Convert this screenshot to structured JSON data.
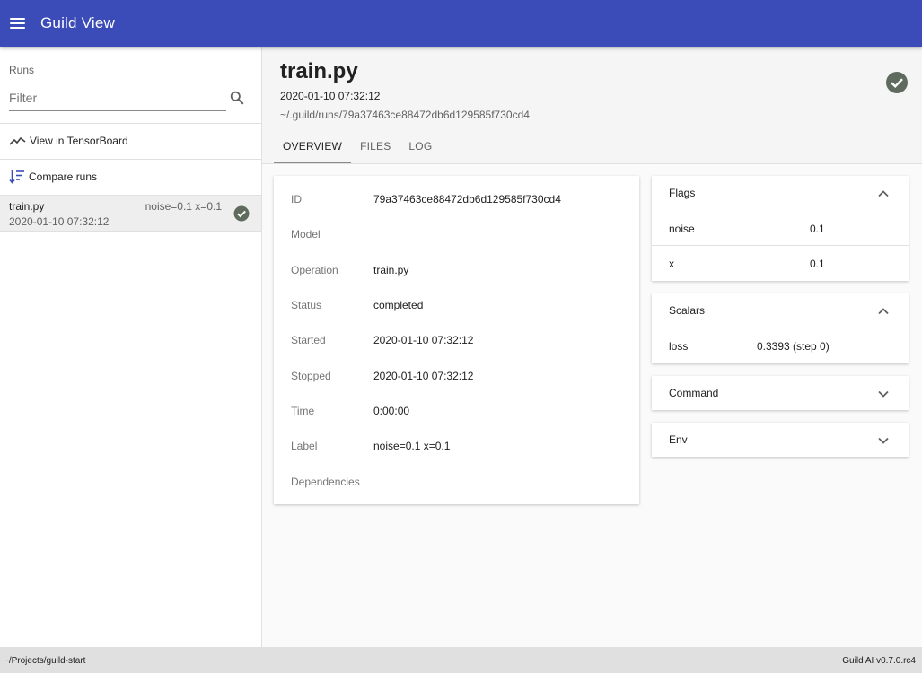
{
  "app": {
    "title": "Guild View",
    "accent": "#3b4cb8"
  },
  "sidebar": {
    "runs_label": "Runs",
    "filter_placeholder": "Filter",
    "actions": {
      "tensorboard": "View in TensorBoard",
      "compare": "Compare runs"
    },
    "runs": [
      {
        "name": "train.py",
        "flags": "noise=0.1 x=0.1",
        "date": "2020-01-10 07:32:12",
        "status": "completed",
        "status_color": "#5f6b5f"
      }
    ]
  },
  "run": {
    "title": "train.py",
    "started": "2020-01-10 07:32:12",
    "dir": "~/.guild/runs/79a37463ce88472db6d129585f730cd4",
    "status_icon": "check-circle-icon"
  },
  "tabs": [
    "OVERVIEW",
    "FILES",
    "LOG"
  ],
  "overview": [
    {
      "label": "ID",
      "value": "79a37463ce88472db6d129585f730cd4"
    },
    {
      "label": "Model",
      "value": ""
    },
    {
      "label": "Operation",
      "value": "train.py"
    },
    {
      "label": "Status",
      "value": "completed"
    },
    {
      "label": "Started",
      "value": "2020-01-10 07:32:12"
    },
    {
      "label": "Stopped",
      "value": "2020-01-10 07:32:12"
    },
    {
      "label": "Time",
      "value": "0:00:00"
    },
    {
      "label": "Label",
      "value": "noise=0.1 x=0.1"
    },
    {
      "label": "Dependencies",
      "value": ""
    }
  ],
  "flags": {
    "title": "Flags",
    "rows": [
      {
        "key": "noise",
        "value": "0.1"
      },
      {
        "key": "x",
        "value": "0.1"
      }
    ]
  },
  "scalars": {
    "title": "Scalars",
    "rows": [
      {
        "key": "loss",
        "value": "0.3393 (step 0)"
      }
    ]
  },
  "command": {
    "title": "Command"
  },
  "env": {
    "title": "Env"
  },
  "statusbar": {
    "project": "~/Projects/guild-start",
    "version": "Guild AI v0.7.0.rc4"
  }
}
